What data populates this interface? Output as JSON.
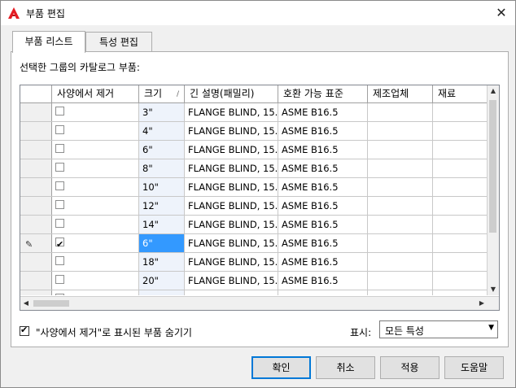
{
  "window": {
    "title": "부품 편집",
    "close_glyph": "✕"
  },
  "tabs": [
    {
      "label": "부품 리스트"
    },
    {
      "label": "특성 편집"
    }
  ],
  "panel": {
    "caption": "선택한 그룹의 카탈로그 부품:"
  },
  "table": {
    "columns": [
      "",
      "사양에서 제거",
      "크기",
      "긴 설명(패밀리)",
      "호환 가능 표준",
      "제조업체",
      "재료"
    ],
    "rows": [
      {
        "remove": false,
        "size": "3\"",
        "desc": "FLANGE BLIND, 15..",
        "standard": "ASME B16.5",
        "editing": false
      },
      {
        "remove": false,
        "size": "4\"",
        "desc": "FLANGE BLIND, 15..",
        "standard": "ASME B16.5",
        "editing": false
      },
      {
        "remove": false,
        "size": "6\"",
        "desc": "FLANGE BLIND, 15..",
        "standard": "ASME B16.5",
        "editing": false
      },
      {
        "remove": false,
        "size": "8\"",
        "desc": "FLANGE BLIND, 15..",
        "standard": "ASME B16.5",
        "editing": false
      },
      {
        "remove": false,
        "size": "10\"",
        "desc": "FLANGE BLIND, 15..",
        "standard": "ASME B16.5",
        "editing": false
      },
      {
        "remove": false,
        "size": "12\"",
        "desc": "FLANGE BLIND, 15..",
        "standard": "ASME B16.5",
        "editing": false
      },
      {
        "remove": false,
        "size": "14\"",
        "desc": "FLANGE BLIND, 15..",
        "standard": "ASME B16.5",
        "editing": false
      },
      {
        "remove": true,
        "size": "6\"",
        "desc": "FLANGE BLIND, 15..",
        "standard": "ASME B16.5",
        "editing": true
      },
      {
        "remove": false,
        "size": "18\"",
        "desc": "FLANGE BLIND, 15..",
        "standard": "ASME B16.5",
        "editing": false
      },
      {
        "remove": false,
        "size": "20\"",
        "desc": "FLANGE BLIND, 15..",
        "standard": "ASME B16.5",
        "editing": false
      },
      {
        "remove": false,
        "size": "",
        "desc": "",
        "standard": "",
        "editing": false
      }
    ]
  },
  "options": {
    "hide_removed_label": "\"사양에서 제거\"로 표시된 부품 숨기기",
    "hide_removed_checked": true,
    "show_label": "표시:",
    "show_value": "모든 특성"
  },
  "buttons": {
    "ok": "확인",
    "cancel": "취소",
    "apply": "적용",
    "help": "도움말"
  },
  "icons": {
    "app": "autocad-a-icon",
    "sort": "sort-indicator-icon",
    "edit_marker": "pencil-icon"
  },
  "colors": {
    "accent": "#0078d7",
    "selection": "#3399ff",
    "app_red": "#e51c23"
  }
}
